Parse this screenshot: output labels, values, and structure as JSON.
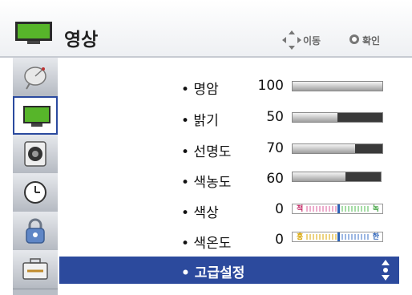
{
  "header": {
    "title": "영상",
    "hint_move": "이동",
    "hint_ok": "확인"
  },
  "sidebar": {
    "items": [
      {
        "name": "satellite-dish-icon",
        "active": false
      },
      {
        "name": "picture-tv-icon",
        "active": true
      },
      {
        "name": "speaker-icon",
        "active": false
      },
      {
        "name": "clock-icon",
        "active": false
      },
      {
        "name": "lock-icon",
        "active": false
      },
      {
        "name": "toolbox-icon",
        "active": false
      }
    ]
  },
  "settings": [
    {
      "label": "• 명암",
      "value": "100",
      "level": 1.0
    },
    {
      "label": "• 밝기",
      "value": "50",
      "level": 0.5
    },
    {
      "label": "• 선명도",
      "value": "70",
      "level": 0.7
    },
    {
      "label": "• 색농도",
      "value": "60",
      "level": 0.6
    },
    {
      "label": "• 색상",
      "value": "0",
      "left_end": "적",
      "right_end": "녹"
    },
    {
      "label": "• 색온도",
      "value": "0",
      "left_end": "홍",
      "right_end": "한"
    }
  ],
  "advanced": {
    "label": "• 고급설정"
  },
  "colors": {
    "highlight": "#2c4a9d",
    "bar_fill": "#3a3a3a"
  }
}
